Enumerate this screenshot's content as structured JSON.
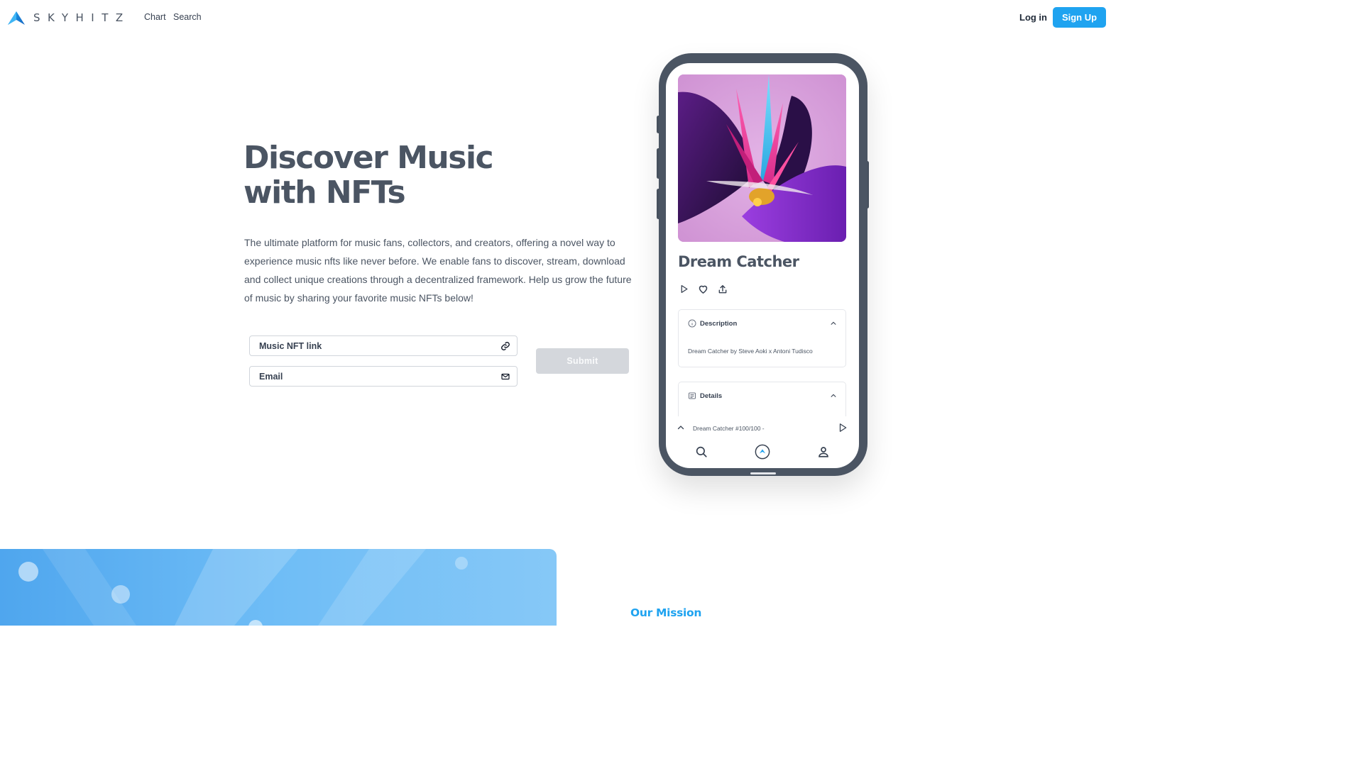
{
  "nav": {
    "brand": "SKYHITZ",
    "links": [
      {
        "label": "Chart"
      },
      {
        "label": "Search"
      }
    ],
    "login_label": "Log in",
    "signup_label": "Sign Up",
    "accent_color": "#1fa3f0"
  },
  "hero": {
    "title_line1": "Discover Music",
    "title_line2": "with NFTs",
    "description": "The ultimate platform for music fans, collectors, and creators, offering a novel way to experience music nfts like never before. We enable fans to discover, stream, download and collect unique creations through a decentralized framework.  Help us grow the future of music by sharing your favorite music NFTs below!",
    "form": {
      "nft_placeholder": "Music NFT link",
      "nft_icon": "link-icon",
      "email_placeholder": "Email",
      "email_icon": "mail-icon",
      "submit_label": "Submit"
    }
  },
  "phone": {
    "track_title": "Dream Catcher",
    "actions": [
      "play-icon",
      "heart-icon",
      "share-icon"
    ],
    "description_card": {
      "title": "Description",
      "body": "Dream Catcher by Steve Aoki x Antoni Tudisco"
    },
    "details_card": {
      "title": "Details"
    },
    "mini_player": {
      "title": "Dream Catcher #100/100 -"
    },
    "tabs": [
      "search-icon",
      "home-logo-icon",
      "profile-icon"
    ]
  },
  "mission": {
    "title": "Our Mission"
  }
}
